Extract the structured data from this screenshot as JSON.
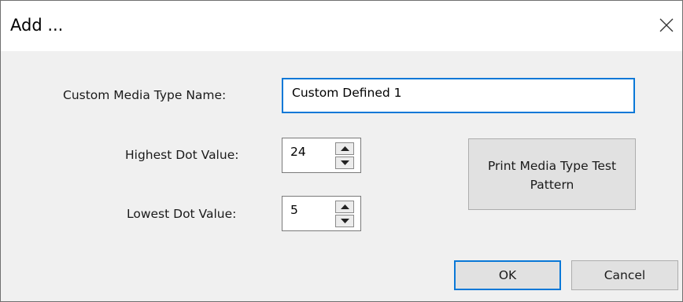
{
  "dialog": {
    "title": "Add ...",
    "close_icon": "close-icon"
  },
  "form": {
    "name_label": "Custom Media Type Name:",
    "name_value": "Custom Defined 1",
    "highest_label": "Highest Dot Value:",
    "highest_value": "24",
    "lowest_label": "Lowest Dot Value:",
    "lowest_value": "5"
  },
  "buttons": {
    "test_pattern_line1": "Print Media Type Test",
    "test_pattern_line2": "Pattern",
    "ok": "OK",
    "cancel": "Cancel"
  },
  "colors": {
    "focus_border": "#0a78d7",
    "dialog_background": "#f0f0f0",
    "button_face": "#e1e1e1"
  }
}
